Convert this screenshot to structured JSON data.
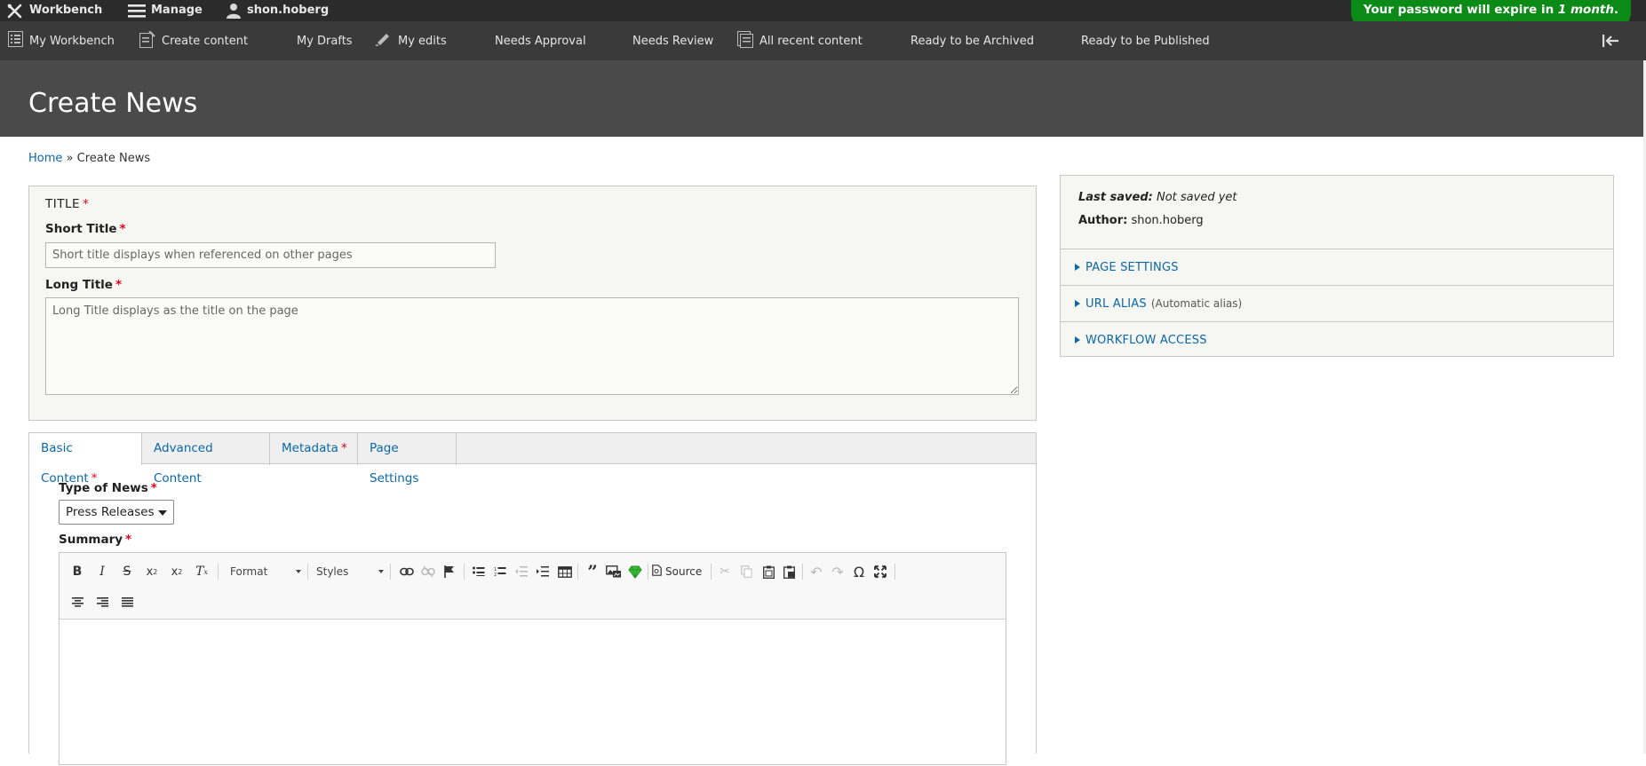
{
  "toolbar": {
    "workbench": "Workbench",
    "manage": "Manage",
    "user": "shon.hoberg",
    "password_notice_prefix": "Your password will expire in ",
    "password_notice_emph": "1 month",
    "password_notice_suffix": "."
  },
  "tray": {
    "items": [
      {
        "label": "My Workbench",
        "icon": "list-icon"
      },
      {
        "label": "Create content",
        "icon": "create-content-icon"
      },
      {
        "label": "My Drafts",
        "icon": ""
      },
      {
        "label": "My edits",
        "icon": "pencil-icon"
      },
      {
        "label": "Needs Approval",
        "icon": ""
      },
      {
        "label": "Needs Review",
        "icon": ""
      },
      {
        "label": "All recent content",
        "icon": "document-icon"
      },
      {
        "label": "Ready to be Archived",
        "icon": ""
      },
      {
        "label": "Ready to be Published",
        "icon": ""
      }
    ]
  },
  "page": {
    "title": "Create News"
  },
  "breadcrumb": {
    "home": "Home",
    "separator": "»",
    "current": "Create News"
  },
  "title_group": {
    "legend": "Title",
    "short_label": "Short Title",
    "short_placeholder": "Short title displays when referenced on other pages",
    "long_label": "Long Title",
    "long_placeholder": "Long Title displays as the title on the page",
    "required_mark": "*"
  },
  "tabs": [
    {
      "label": "Basic Content",
      "required": true
    },
    {
      "label": "Advanced Content",
      "required": false
    },
    {
      "label": "Metadata",
      "required": true
    },
    {
      "label": "Page Settings",
      "required": false
    }
  ],
  "basic": {
    "news_type_label": "Type of News",
    "news_type_value": "Press Releases",
    "summary_label": "Summary"
  },
  "editor": {
    "format_label": "Format",
    "styles_label": "Styles",
    "source_label": "Source"
  },
  "sidebar": {
    "last_saved_label": "Last saved:",
    "last_saved_value": "Not saved yet",
    "author_label": "Author:",
    "author_value": "shon.hoberg",
    "sections": [
      {
        "label": "Page Settings",
        "sub": ""
      },
      {
        "label": "URL Alias",
        "sub": "(Automatic alias)"
      },
      {
        "label": "Workflow Access",
        "sub": ""
      }
    ]
  },
  "colors": {
    "link": "#0a67a8",
    "required": "#e2001a",
    "notice_bg": "#0b8a17",
    "header_bg": "#4a4a4a"
  }
}
